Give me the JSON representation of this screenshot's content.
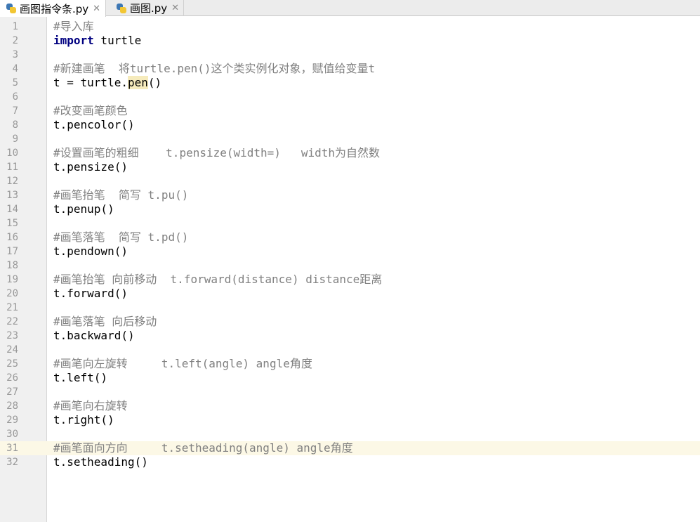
{
  "tabs": [
    {
      "label": "画图指令条.py",
      "close": "✕",
      "active": true
    },
    {
      "label": "画图.py",
      "close": "✕",
      "active": false
    }
  ],
  "editor": {
    "current_line": 31,
    "lines": [
      {
        "n": "1",
        "segments": [
          {
            "t": "#导入库",
            "c": "cmt"
          }
        ]
      },
      {
        "n": "2",
        "segments": [
          {
            "t": "import",
            "c": "kw"
          },
          {
            "t": " turtle",
            "c": ""
          }
        ]
      },
      {
        "n": "3",
        "segments": []
      },
      {
        "n": "4",
        "segments": [
          {
            "t": "#新建画笔  将",
            "c": "cmt"
          },
          {
            "t": "turtle.pen()",
            "c": "cmt it"
          },
          {
            "t": "这个类实例化对象，赋值给变量",
            "c": "cmt"
          },
          {
            "t": "t",
            "c": "cmt it"
          }
        ]
      },
      {
        "n": "5",
        "segments": [
          {
            "t": "t = turtle.",
            "c": ""
          },
          {
            "t": "pen",
            "c": "hl"
          },
          {
            "t": "()",
            "c": ""
          }
        ]
      },
      {
        "n": "6",
        "segments": []
      },
      {
        "n": "7",
        "segments": [
          {
            "t": "#改变画笔颜色",
            "c": "cmt"
          }
        ]
      },
      {
        "n": "8",
        "segments": [
          {
            "t": "t.pencolor()",
            "c": ""
          }
        ]
      },
      {
        "n": "9",
        "segments": []
      },
      {
        "n": "10",
        "segments": [
          {
            "t": "#设置画笔的粗细    ",
            "c": "cmt"
          },
          {
            "t": "t.pensize(width=)",
            "c": "cmt it"
          },
          {
            "t": "   ",
            "c": "cmt"
          },
          {
            "t": "width",
            "c": "cmt it"
          },
          {
            "t": "为自然数",
            "c": "cmt"
          }
        ]
      },
      {
        "n": "11",
        "segments": [
          {
            "t": "t.pensize()",
            "c": ""
          }
        ]
      },
      {
        "n": "12",
        "segments": []
      },
      {
        "n": "13",
        "segments": [
          {
            "t": "#画笔抬笔  简写 ",
            "c": "cmt"
          },
          {
            "t": "t.pu()",
            "c": "cmt it"
          }
        ]
      },
      {
        "n": "14",
        "segments": [
          {
            "t": "t.penup()",
            "c": ""
          }
        ]
      },
      {
        "n": "15",
        "segments": []
      },
      {
        "n": "16",
        "segments": [
          {
            "t": "#画笔落笔  简写 ",
            "c": "cmt"
          },
          {
            "t": "t.pd()",
            "c": "cmt it"
          }
        ]
      },
      {
        "n": "17",
        "segments": [
          {
            "t": "t.pendown()",
            "c": ""
          }
        ]
      },
      {
        "n": "18",
        "segments": []
      },
      {
        "n": "19",
        "segments": [
          {
            "t": "#画笔抬笔 向前移动  ",
            "c": "cmt"
          },
          {
            "t": "t.forward(distance) distance",
            "c": "cmt it"
          },
          {
            "t": "距离",
            "c": "cmt"
          }
        ]
      },
      {
        "n": "20",
        "segments": [
          {
            "t": "t.forward()",
            "c": ""
          }
        ]
      },
      {
        "n": "21",
        "segments": []
      },
      {
        "n": "22",
        "segments": [
          {
            "t": "#画笔落笔 向后移动",
            "c": "cmt"
          }
        ]
      },
      {
        "n": "23",
        "segments": [
          {
            "t": "t.backward()",
            "c": ""
          }
        ]
      },
      {
        "n": "24",
        "segments": []
      },
      {
        "n": "25",
        "segments": [
          {
            "t": "#画笔向左旋转     ",
            "c": "cmt"
          },
          {
            "t": "t.left(angle) angle",
            "c": "cmt it"
          },
          {
            "t": "角度",
            "c": "cmt"
          }
        ]
      },
      {
        "n": "26",
        "segments": [
          {
            "t": "t.left()",
            "c": ""
          }
        ]
      },
      {
        "n": "27",
        "segments": []
      },
      {
        "n": "28",
        "segments": [
          {
            "t": "#画笔向右旋转",
            "c": "cmt"
          }
        ]
      },
      {
        "n": "29",
        "segments": [
          {
            "t": "t.right()",
            "c": ""
          }
        ]
      },
      {
        "n": "30",
        "segments": []
      },
      {
        "n": "31",
        "segments": [
          {
            "t": "#画笔面向方向     ",
            "c": "cmt"
          },
          {
            "t": "t.setheading(angle) angle",
            "c": "cmt it"
          },
          {
            "t": "角度",
            "c": "cmt"
          }
        ]
      },
      {
        "n": "32",
        "segments": [
          {
            "t": "t.setheading()",
            "c": ""
          }
        ]
      }
    ]
  }
}
